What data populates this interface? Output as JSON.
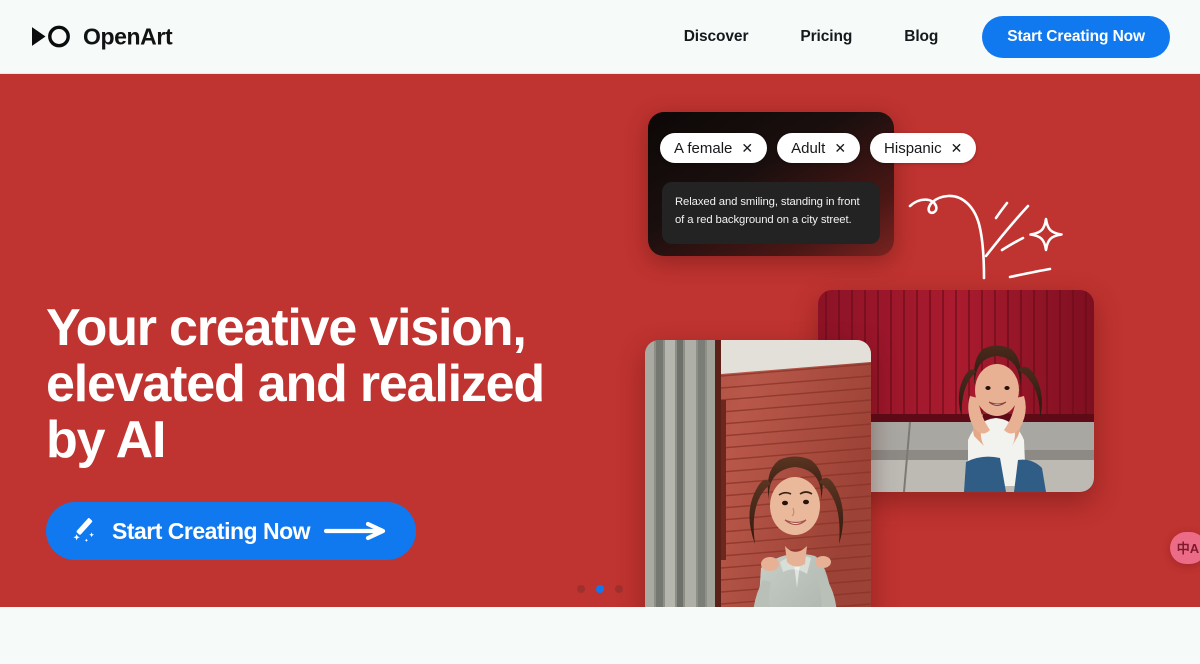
{
  "header": {
    "brand": {
      "name": "OpenArt",
      "logo_icon": "openart-infinity-logo"
    },
    "nav": [
      {
        "label": "Discover"
      },
      {
        "label": "Pricing"
      },
      {
        "label": "Blog"
      }
    ],
    "cta": {
      "label": "Start Creating Now"
    }
  },
  "hero": {
    "title": "Your creative vision,\nelevated and realized\nby AI",
    "cta": {
      "label": "Start Creating Now",
      "icon": "magic-wand-icon",
      "arrow_icon": "arrow-right-icon"
    },
    "prompt_panel": {
      "chips": [
        {
          "label": "A female",
          "remove_icon": "close-icon"
        },
        {
          "label": "Adult",
          "remove_icon": "close-icon"
        },
        {
          "label": "Hispanic",
          "remove_icon": "close-icon"
        }
      ],
      "prompt_text": "Relaxed and smiling, standing in front of a red background on a city street."
    },
    "decoration": {
      "icon": "doodle-swoosh-sparkle"
    },
    "images": [
      {
        "name": "woman-sitting-against-red-corrugated-wall",
        "alt": "Smiling woman sitting with hands on face, white t-shirt and blue jeans, dark red corrugated wall and concrete ledge"
      },
      {
        "name": "woman-standing-against-red-corrugated-wall",
        "alt": "Smiling woman standing in grey cold-shoulder top in front of a red corrugated wall with silver metal panels"
      }
    ],
    "carousel": {
      "total": 3,
      "active_index": 1
    },
    "translate_widget": {
      "glyph": "中A",
      "icon": "translate-icon"
    }
  },
  "colors": {
    "hero_red": "#bf3330",
    "accent_blue": "#1079ef",
    "header_bg": "#f6faf9",
    "chip_white": "#ffffff",
    "prompt_box": "#232323",
    "translate_pink": "#ec6b86"
  }
}
